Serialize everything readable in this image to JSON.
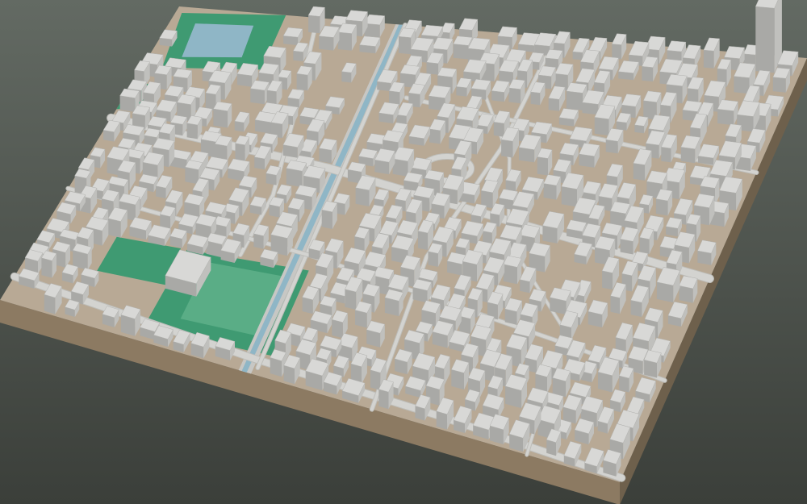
{
  "scene": {
    "type": "3d-city-block-model",
    "colors": {
      "background_top": "#636a63",
      "background_bottom": "#3b3f3a",
      "ground": "#b8a995",
      "base_side": "#8c7a62",
      "base_side_dark": "#6e604c",
      "road": "#d3d3d0",
      "road_edge": "#bdbdb9",
      "building_top": "#d8d8d6",
      "building_left": "#a9a9a6",
      "building_right": "#c0c0bd",
      "park": "#3f9a72",
      "park_light": "#5aad86",
      "water": "#8fb6c6",
      "canal_wall": "#c7c7c4"
    },
    "features": [
      "pond-park",
      "canal",
      "roundabout",
      "rail-line",
      "sports-field",
      "park",
      "tower",
      "urban-blocks"
    ]
  }
}
